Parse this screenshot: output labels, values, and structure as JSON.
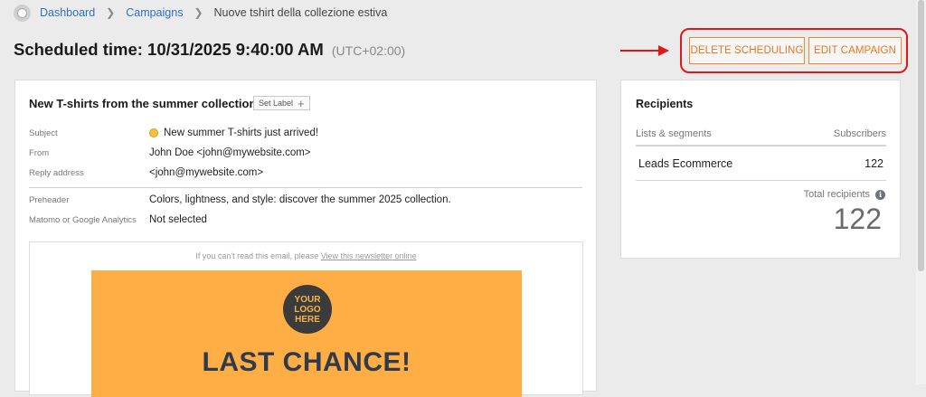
{
  "breadcrumb": {
    "items": [
      "Dashboard",
      "Campaigns"
    ],
    "current": "Nuove tshirt della collezione estiva"
  },
  "header": {
    "scheduled_label": "Scheduled time: 10/31/2025 9:40:00 AM",
    "timezone": "(UTC+02:00)"
  },
  "actions": {
    "delete_label": "DELETE SCHEDULING",
    "edit_label": "EDIT CAMPAIGN"
  },
  "campaign": {
    "title": "New T-shirts from the summer collection",
    "set_label": "Set Label",
    "fields": {
      "subject_label": "Subject",
      "subject_value": "New summer T-shirts just arrived!",
      "from_label": "From",
      "from_value": "John Doe <john@mywebsite.com>",
      "reply_label": "Reply address",
      "reply_value": "<john@mywebsite.com>",
      "preheader_label": "Preheader",
      "preheader_value": "Colors, lightness, and style: discover the summer 2025 collection.",
      "analytics_label": "Matomo or Google Analytics",
      "analytics_value": "Not selected"
    }
  },
  "preview": {
    "read_prefix": "If you can't read this email, please ",
    "read_link": "View this newsletter online",
    "logo_line1": "YOUR",
    "logo_line2": "LOGO",
    "logo_line3": "HERE",
    "headline": "LAST CHANCE!"
  },
  "recipients": {
    "title": "Recipients",
    "col_lists": "Lists & segments",
    "col_subscribers": "Subscribers",
    "rows": [
      {
        "name": "Leads Ecommerce",
        "count": "122"
      }
    ],
    "total_label": "Total recipients",
    "total_value": "122"
  },
  "colors": {
    "accent_orange": "#ef8a2e",
    "highlight_red": "#e01818",
    "banner_orange": "#ffae45",
    "link_blue": "#2e6fc4"
  },
  "icons": [
    "home-icon",
    "chevron-right-icon",
    "plus-icon",
    "emoji-icon",
    "arrow-right-icon",
    "info-icon"
  ]
}
